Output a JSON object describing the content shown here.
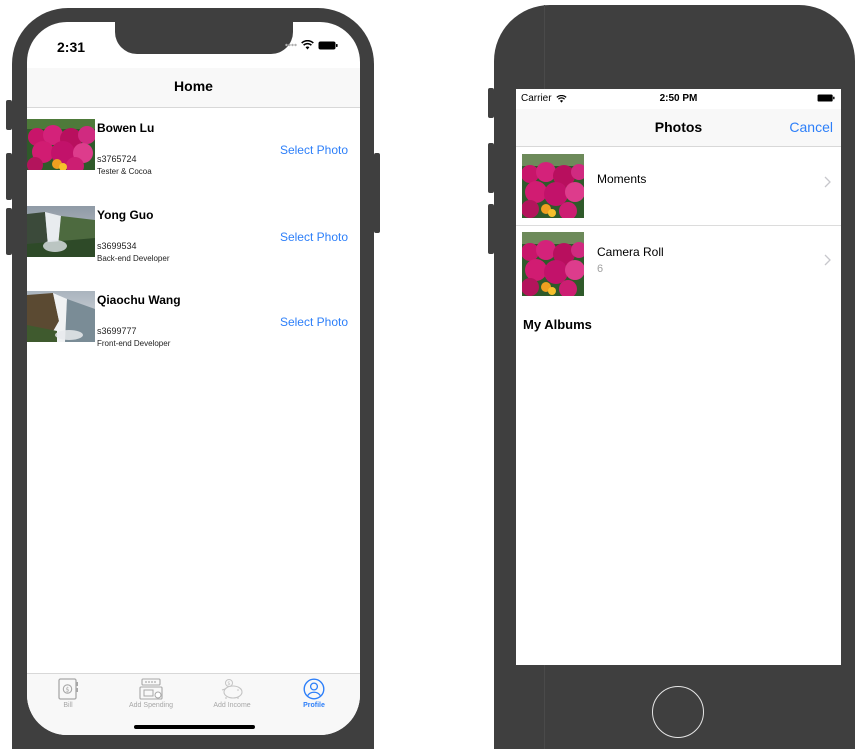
{
  "phone1": {
    "status_time": "2:31",
    "nav_title": "Home",
    "members": [
      {
        "name": "Bowen Lu",
        "id": "s3765724",
        "role": "Tester & Cocoa",
        "action": "Select Photo"
      },
      {
        "name": "Yong Guo",
        "id": "s3699534",
        "role": "Back-end Developer",
        "action": "Select Photo"
      },
      {
        "name": "Qiaochu Wang",
        "id": "s3699777",
        "role": "Front-end Developer",
        "action": "Select Photo"
      }
    ],
    "tabs": [
      {
        "label": "Bill",
        "icon": "bill-book-icon",
        "active": false
      },
      {
        "label": "Add Spending",
        "icon": "cash-register-icon",
        "active": false
      },
      {
        "label": "Add Income",
        "icon": "piggy-bank-icon",
        "active": false
      },
      {
        "label": "Profile",
        "icon": "profile-icon",
        "active": true
      }
    ]
  },
  "phone2": {
    "carrier": "Carrier",
    "status_time": "2:50 PM",
    "nav_title": "Photos",
    "cancel_label": "Cancel",
    "albums": [
      {
        "name": "Moments",
        "count": ""
      },
      {
        "name": "Camera Roll",
        "count": "6"
      }
    ],
    "section_title": "My Albums"
  },
  "colors": {
    "accent": "#2d7ff9",
    "device": "#3f3f3f",
    "inactive_tab": "#a7a7a7"
  }
}
